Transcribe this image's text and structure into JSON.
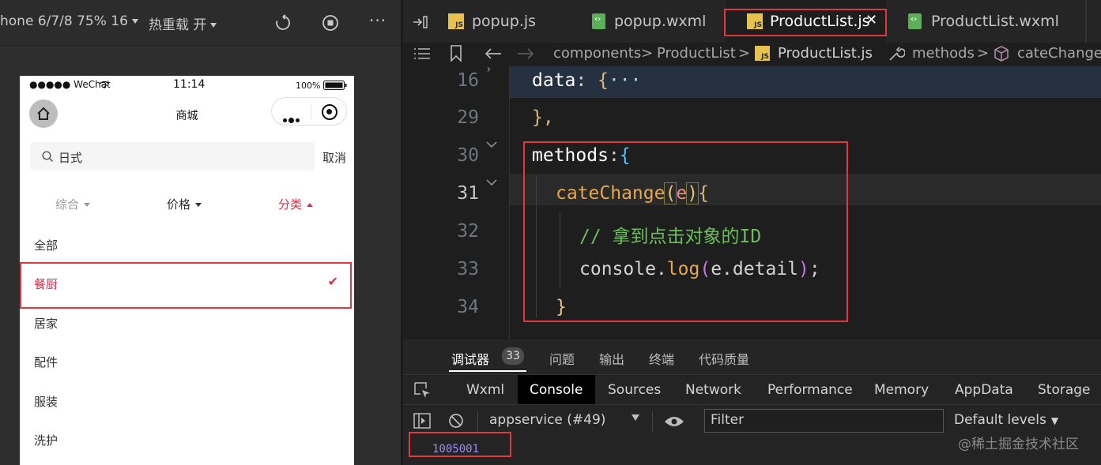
{
  "simulator": {
    "device": "hone 6/7/8 75% 16",
    "hot_reload": "热重载 开"
  },
  "phone": {
    "status": {
      "carrier": "●●●●● WeChat",
      "time": "11:14",
      "battery": "100%"
    },
    "nav_title": "商城",
    "search_value": "日式",
    "cancel_label": "取消",
    "sort_options": [
      {
        "label": "综合",
        "state": "down",
        "color": "#999999"
      },
      {
        "label": "价格",
        "state": "down",
        "color": "#333333"
      },
      {
        "label": "分类",
        "state": "up",
        "color": "#d6304a"
      }
    ],
    "categories": [
      {
        "label": "全部",
        "selected": false
      },
      {
        "label": "餐厨",
        "selected": true
      },
      {
        "label": "居家",
        "selected": false
      },
      {
        "label": "配件",
        "selected": false
      },
      {
        "label": "服装",
        "selected": false
      },
      {
        "label": "洗护",
        "selected": false
      }
    ],
    "accent_color": "#d6304a"
  },
  "editor": {
    "tabs": [
      {
        "label": "popup.js",
        "icon": "js-file-icon",
        "active": false
      },
      {
        "label": "popup.wxml",
        "icon": "wxml-file-icon",
        "active": false
      },
      {
        "label": "ProductList.js",
        "icon": "js-file-icon",
        "active": true,
        "close": "✕"
      },
      {
        "label": "ProductList.wxml",
        "icon": "wxml-file-icon",
        "active": false
      }
    ],
    "breadcrumb": {
      "part1": "components",
      "part2": "ProductList",
      "part3": "ProductList.js",
      "part4": "methods",
      "part5": "cateChange",
      "sep": ">"
    },
    "code_lines": [
      {
        "num": "16",
        "tokens": {
          "a": "data",
          "b": ": ",
          "c": "{",
          "d": "···"
        }
      },
      {
        "num": "29",
        "tokens": {
          "a": "},"
        }
      },
      {
        "num": "30",
        "tokens": {
          "a": "methods",
          "b": ":",
          "c": "{"
        }
      },
      {
        "num": "31",
        "tokens": {
          "a": "cateChange",
          "b": "(",
          "c": "e",
          "d": ")",
          "e": "{"
        }
      },
      {
        "num": "32",
        "tokens": {
          "a": "// 拿到点击对象的ID"
        }
      },
      {
        "num": "33",
        "tokens": {
          "a": "console",
          "b": ".",
          "c": "log",
          "d": "(",
          "e": "e.detail",
          "f": ")",
          "g": ";"
        }
      },
      {
        "num": "34",
        "tokens": {
          "a": "}"
        }
      }
    ]
  },
  "devtools": {
    "top_tabs": {
      "debugger": "调试器",
      "count": "33",
      "problems": "问题",
      "output": "输出",
      "terminal": "终端",
      "quality": "代码质量"
    },
    "panel_tabs": [
      "Wxml",
      "Console",
      "Sources",
      "Network",
      "Performance",
      "Memory",
      "AppData",
      "Storage"
    ],
    "active_panel": "Console",
    "context": "appservice (#49)",
    "filter_placeholder": "Filter",
    "levels": "Default levels",
    "output_value": "1005001"
  },
  "watermark": "@稀土掘金技术社区"
}
